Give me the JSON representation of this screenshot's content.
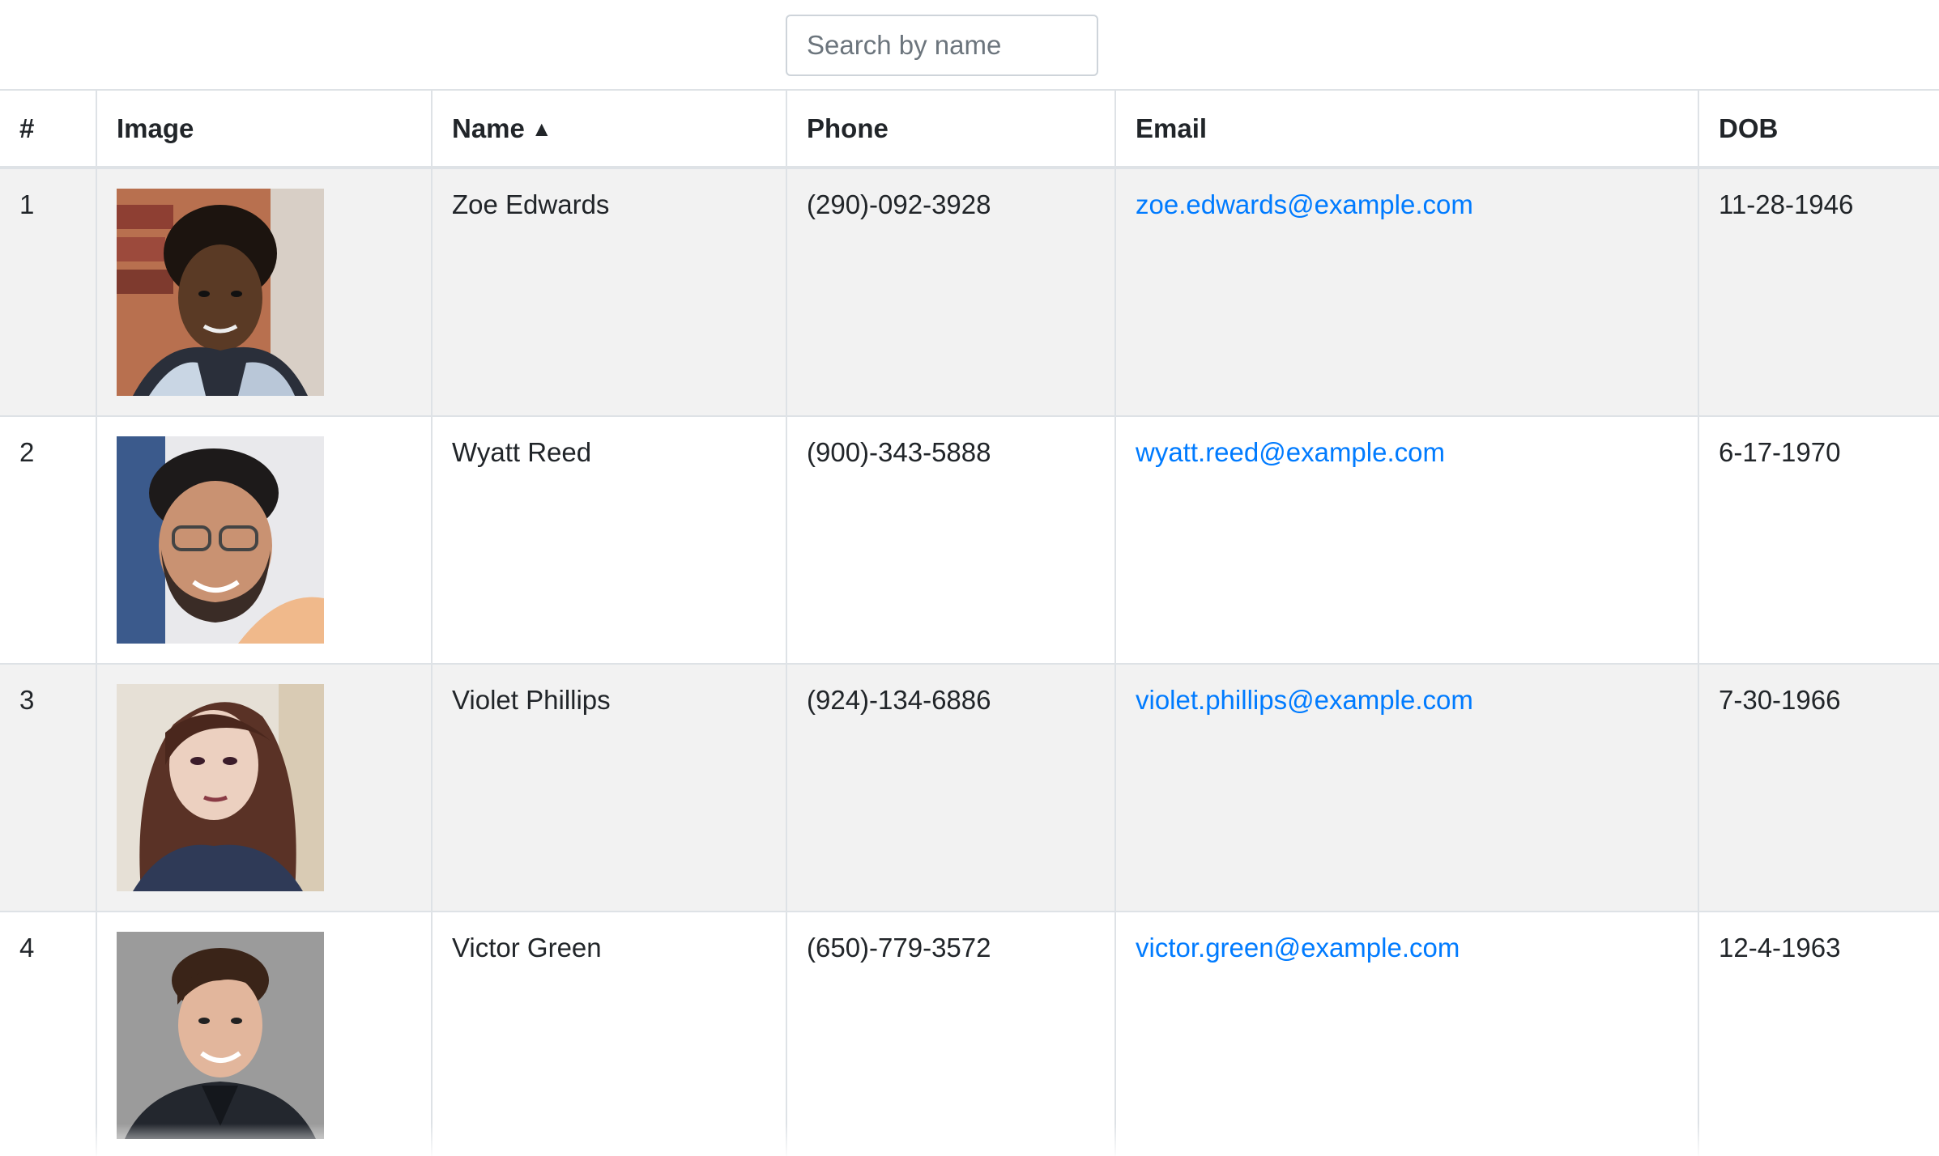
{
  "search": {
    "placeholder": "Search by name",
    "value": ""
  },
  "table": {
    "headers": {
      "num": "#",
      "image": "Image",
      "name": "Name",
      "name_sort_icon": "sort-ascending-icon",
      "phone": "Phone",
      "email": "Email",
      "dob": "DOB"
    },
    "rows": [
      {
        "num": "1",
        "name": "Zoe Edwards",
        "phone": "(290)-092-3928",
        "email": "zoe.edwards@example.com",
        "dob": "11-28-1946"
      },
      {
        "num": "2",
        "name": "Wyatt Reed",
        "phone": "(900)-343-5888",
        "email": "wyatt.reed@example.com",
        "dob": "6-17-1970"
      },
      {
        "num": "3",
        "name": "Violet Phillips",
        "phone": "(924)-134-6886",
        "email": "violet.phillips@example.com",
        "dob": "7-30-1966"
      },
      {
        "num": "4",
        "name": "Victor Green",
        "phone": "(650)-779-3572",
        "email": "victor.green@example.com",
        "dob": "12-4-1963"
      }
    ]
  },
  "colors": {
    "link": "#007bff",
    "stripe": "#f2f2f2",
    "border": "#dee2e6",
    "text": "#212529"
  }
}
